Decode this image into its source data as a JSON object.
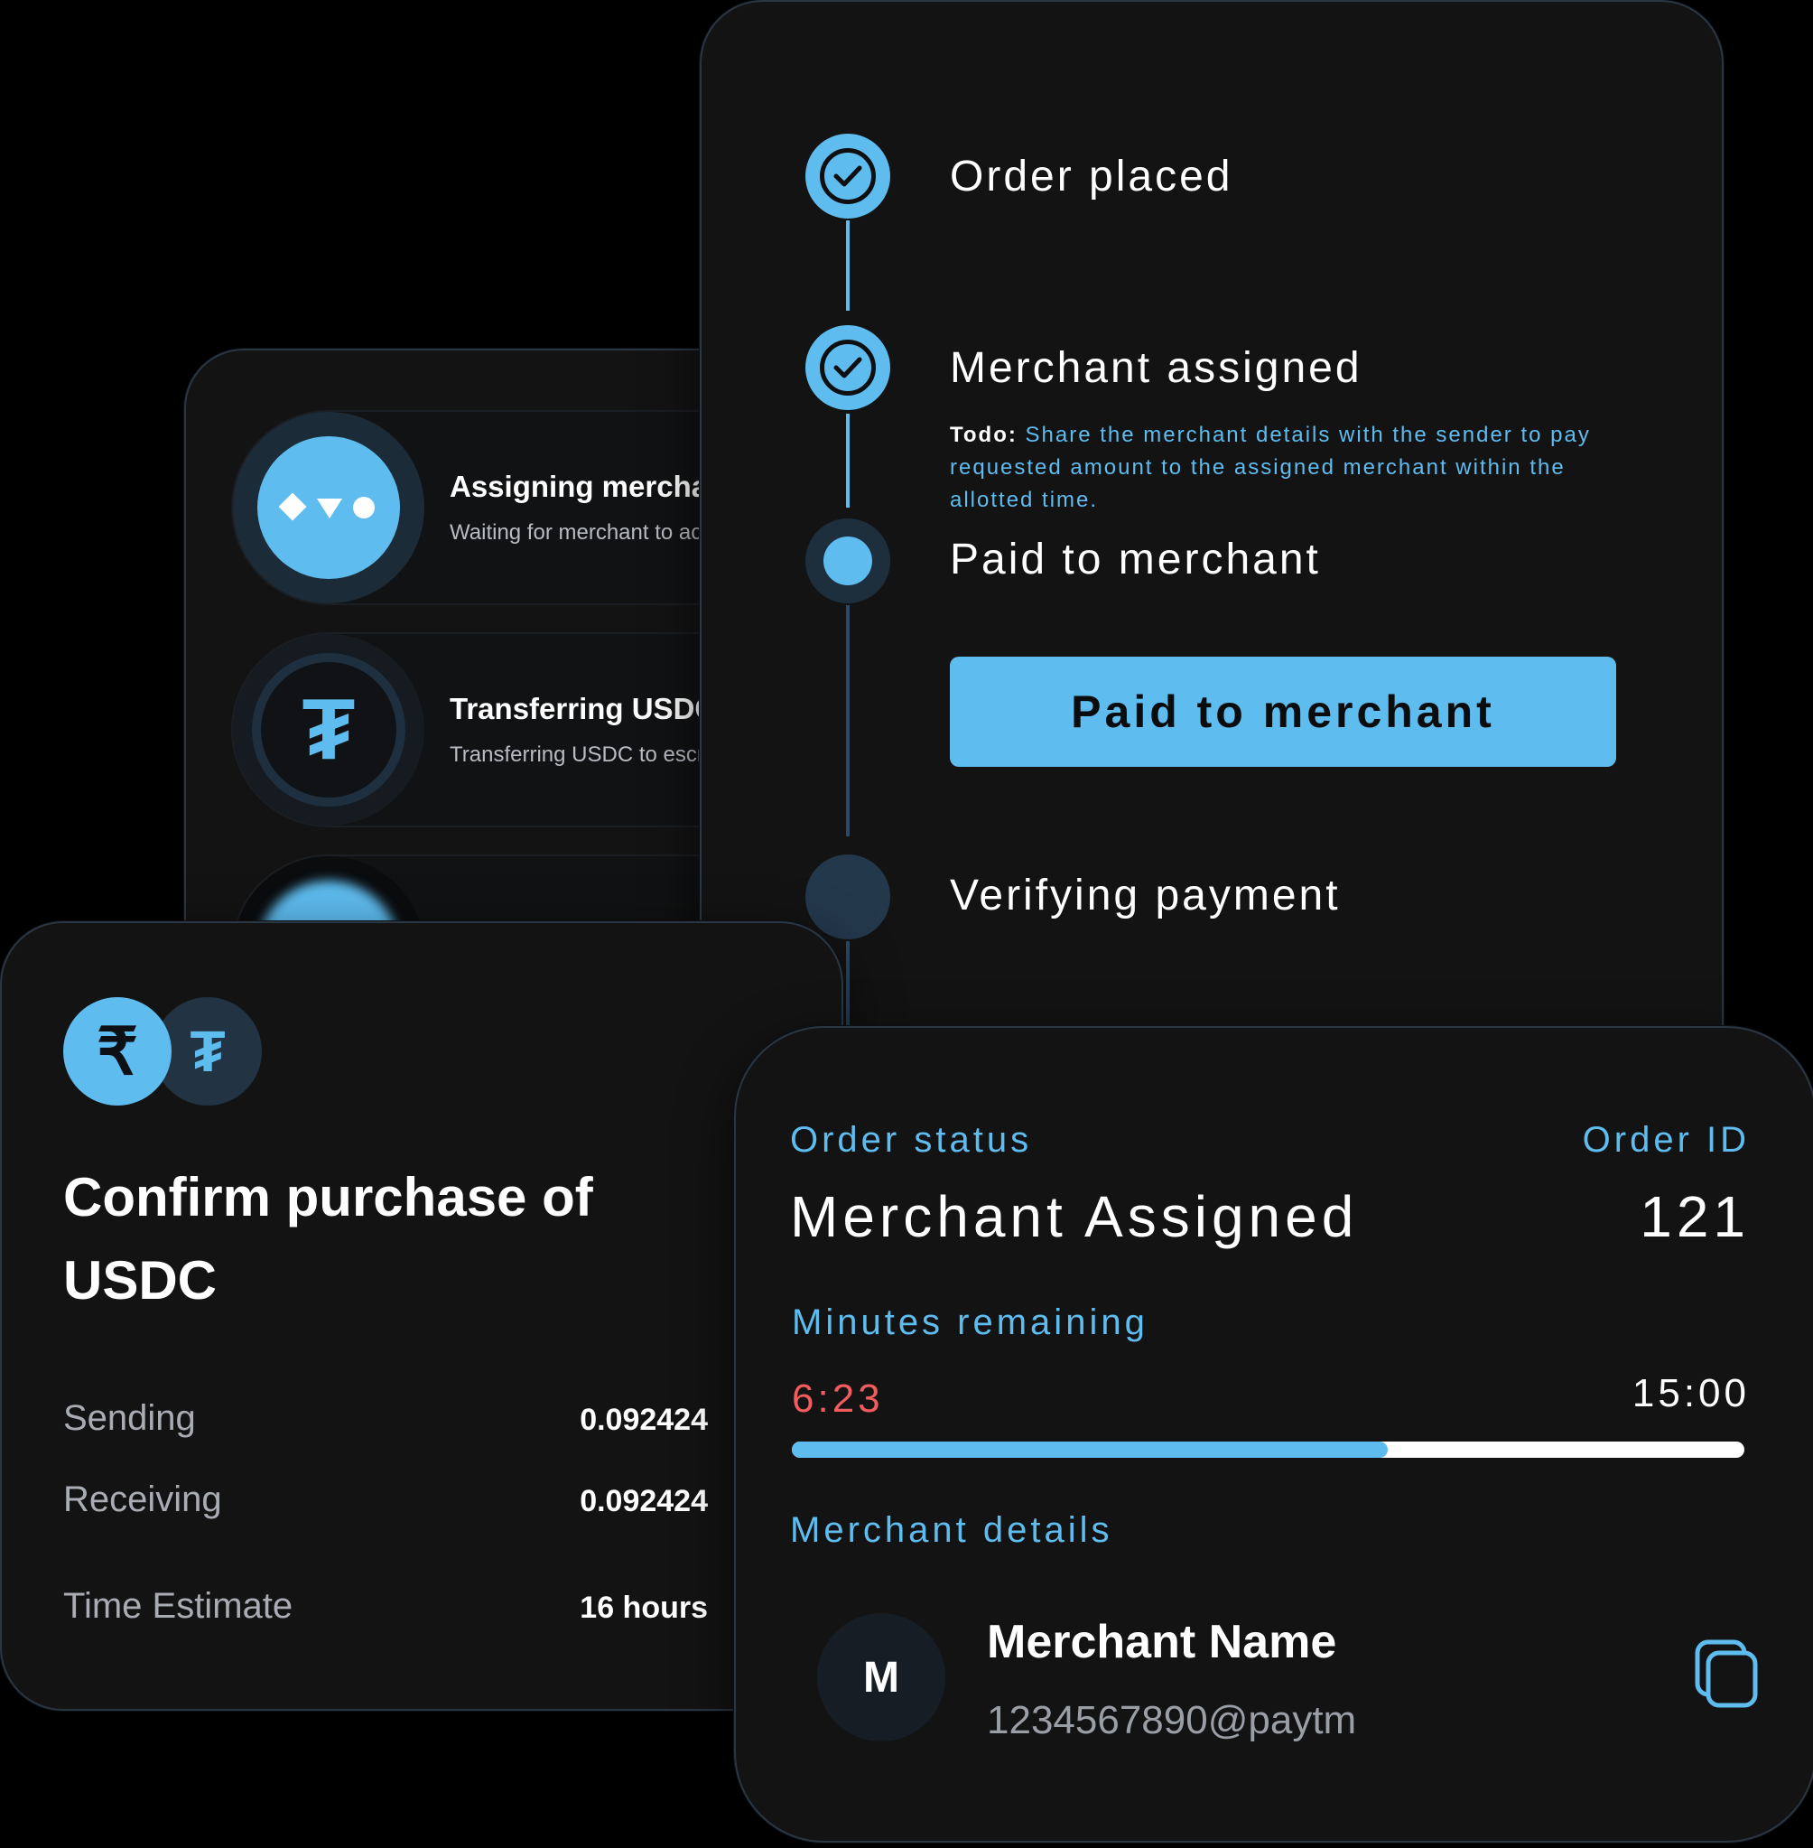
{
  "list_card": {
    "items": [
      {
        "icon": "three-shapes-icon",
        "title": "Assigning merchant",
        "subtitle": "Waiting for merchant to accept"
      },
      {
        "icon": "tether-icon",
        "title": "Transferring USDC",
        "subtitle": "Transferring USDC to escrow"
      }
    ]
  },
  "tracker": {
    "steps": [
      {
        "label": "Order placed",
        "state": "done"
      },
      {
        "label": "Merchant assigned",
        "state": "done"
      },
      {
        "label": "Paid to merchant",
        "state": "current"
      },
      {
        "label": "Verifying payment",
        "state": "pending"
      }
    ],
    "todo_prefix": "Todo:",
    "todo_text": "Share the merchant details with the sender to pay requested amount to the assigned merchant within the allotted time.",
    "button_label": "Paid to merchant"
  },
  "confirm": {
    "coins": [
      "₹",
      "₮"
    ],
    "title": "Confirm purchase of USDC",
    "rows": [
      {
        "label": "Sending",
        "value": "0.092424"
      },
      {
        "label": "Receiving",
        "value": "0.092424"
      },
      {
        "label": "Time Estimate",
        "value": "16 hours"
      }
    ]
  },
  "status": {
    "order_status_label": "Order status",
    "order_status_value": "Merchant Assigned",
    "order_id_label": "Order ID",
    "order_id_value": "121",
    "minutes_label": "Minutes remaining",
    "time_left": "6:23",
    "time_total": "15:00",
    "progress_fraction": 0.626,
    "merchant_details_label": "Merchant details",
    "merchant_initial": "M",
    "merchant_name": "Merchant Name",
    "merchant_upi": "1234567890@paytm"
  },
  "colors": {
    "accent": "#5ebcef",
    "timer_red": "#f25c5c",
    "background": "#000000",
    "card": "#131314"
  }
}
